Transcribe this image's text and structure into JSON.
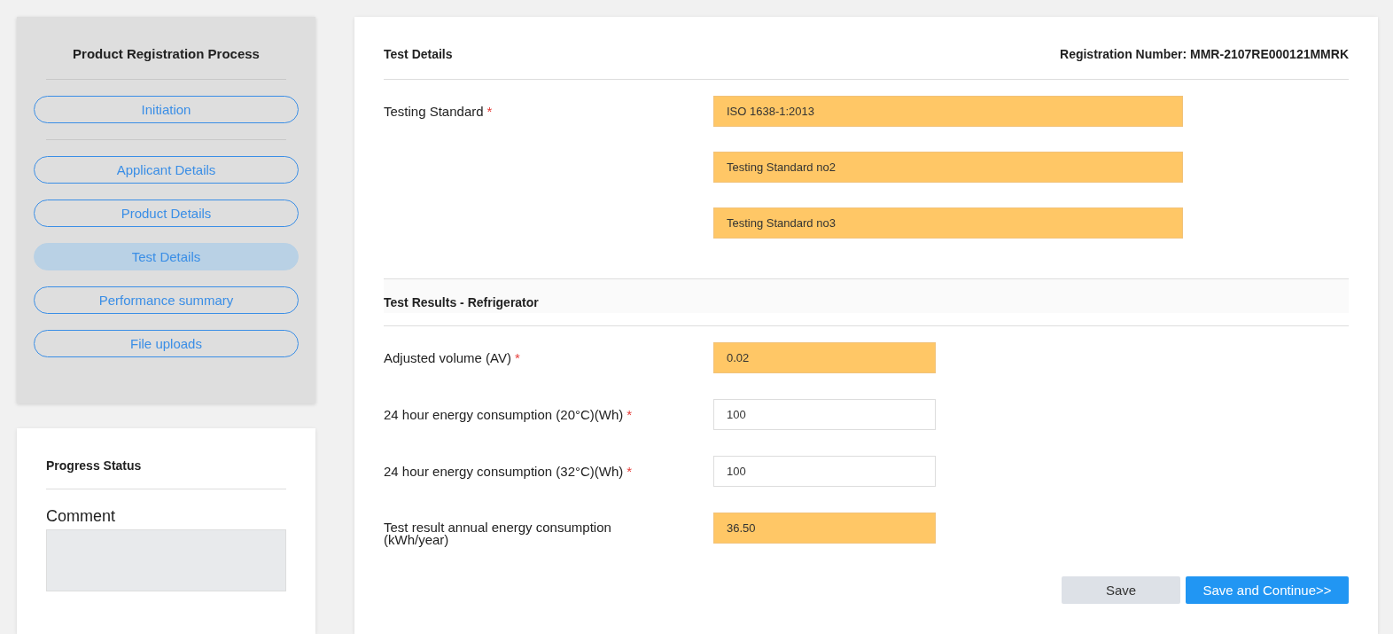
{
  "sidebar": {
    "title": "Product Registration Process",
    "items": [
      {
        "label": "Initiation",
        "selected": false
      },
      {
        "label": "Applicant Details",
        "selected": false
      },
      {
        "label": "Product Details",
        "selected": false
      },
      {
        "label": "Test Details",
        "selected": true
      },
      {
        "label": "Performance summary",
        "selected": false
      },
      {
        "label": "File uploads",
        "selected": false
      }
    ]
  },
  "progress": {
    "title": "Progress Status",
    "comment_label": "Comment"
  },
  "main": {
    "title": "Test Details",
    "registration": "Registration Number: MMR-2107RE000121MMRK",
    "standard": {
      "label": "Testing Standard",
      "required_mark": "*",
      "values": [
        {
          "value": "ISO 1638-1:2013",
          "highlighted": true
        },
        {
          "value": "Testing Standard no2",
          "highlighted": true
        },
        {
          "value": "Testing Standard no3",
          "highlighted": true
        }
      ]
    },
    "results_title": "Test Results - Refrigerator",
    "fields": [
      {
        "label": "Adjusted volume (AV)",
        "required_mark": "*",
        "value": "0.02",
        "highlighted": true
      },
      {
        "label": "24 hour energy consumption (20°C)(Wh)",
        "required_mark": "*",
        "value": "100",
        "highlighted": false
      },
      {
        "label": "24 hour energy consumption (32°C)(Wh)",
        "required_mark": "*",
        "value": "100",
        "highlighted": false
      },
      {
        "label": "Test result annual energy consumption (kWh/year)",
        "value": "36.50",
        "highlighted": true
      }
    ],
    "buttons": [
      {
        "label": "Save",
        "kind": "secondary"
      },
      {
        "label": "Save and Continue>>",
        "kind": "primary"
      }
    ]
  }
}
